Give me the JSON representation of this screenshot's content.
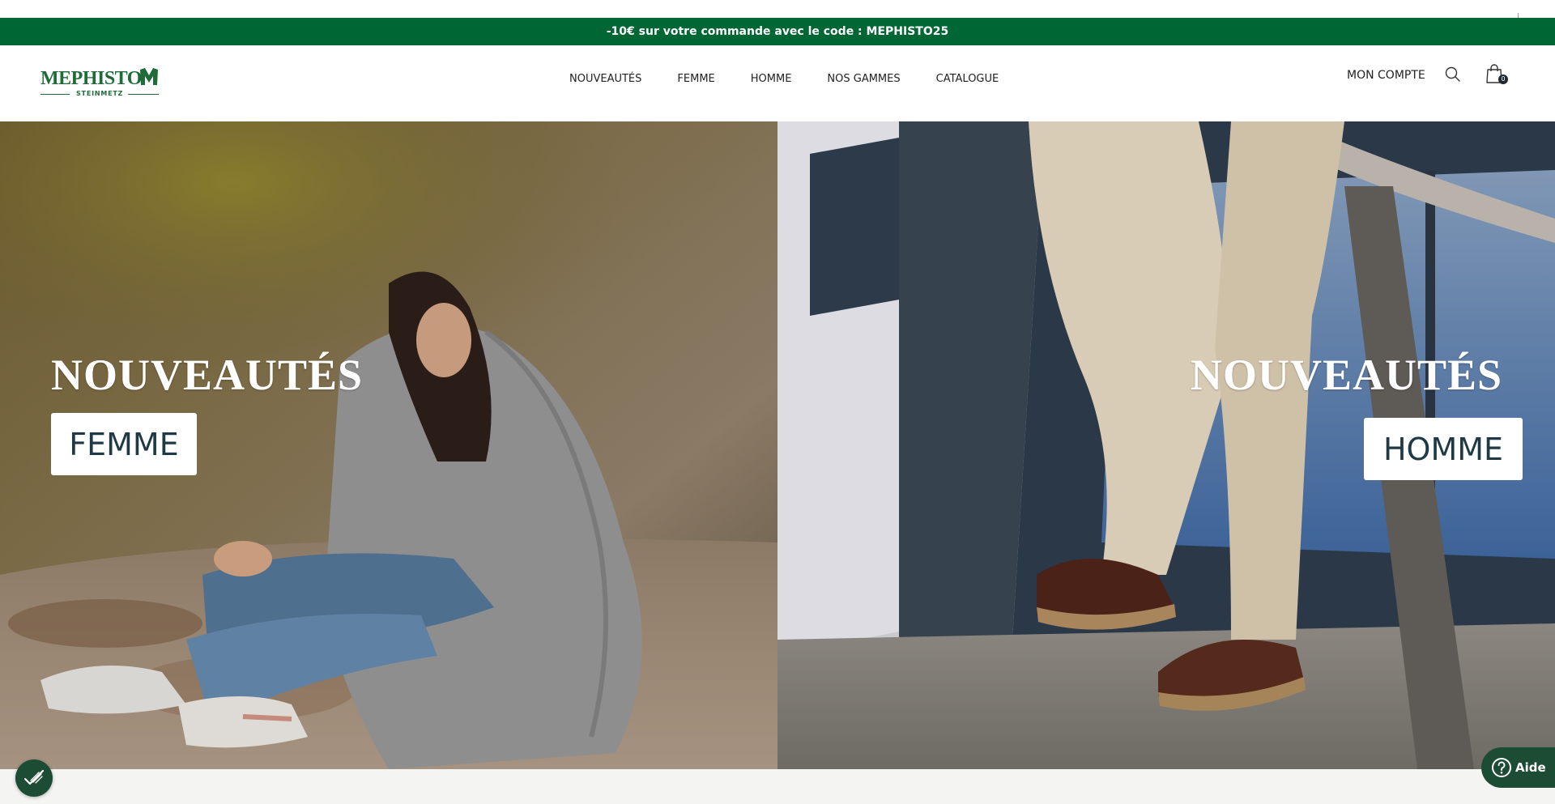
{
  "promo": {
    "text": "-10€ sur votre commande avec le code : MEPHISTO25"
  },
  "brand": {
    "name": "MEPHISTO",
    "sub": "STEINMETZ",
    "color": "#1f6b3a"
  },
  "nav": {
    "items": [
      {
        "label": "NOUVEAUTÉS"
      },
      {
        "label": "FEMME"
      },
      {
        "label": "HOMME"
      },
      {
        "label": "NOS GAMMES"
      },
      {
        "label": "CATALOGUE"
      }
    ]
  },
  "header_actions": {
    "account_label": "MON COMPTE",
    "search_icon": "search-icon",
    "cart_icon": "shopping-bag-icon",
    "cart_count": "0"
  },
  "hero": {
    "left": {
      "title": "NOUVEAUTÉS",
      "button_label": "FEMME"
    },
    "right": {
      "title": "NOUVEAUTÉS",
      "button_label": "HOMME"
    }
  },
  "widgets": {
    "accessibility_icon": "accessibility-icon",
    "help_label": "Aide",
    "help_icon": "question-circle-icon"
  },
  "colors": {
    "promo_bg": "#006633",
    "widget_bg": "#1c4c33",
    "page_bg": "#f4f4f2"
  }
}
